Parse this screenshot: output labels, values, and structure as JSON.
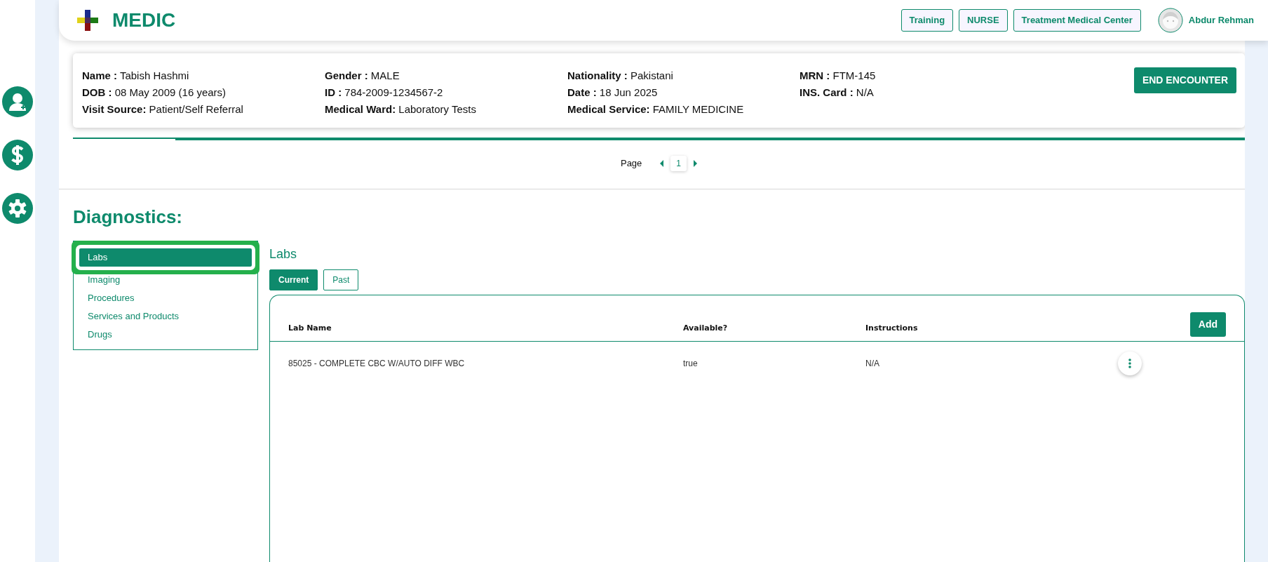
{
  "header": {
    "logo_text": "MEDIC",
    "badges": [
      "Training",
      "NURSE",
      "Treatment Medical Center"
    ],
    "user_name": "Abdur Rehman"
  },
  "patient": {
    "columns": [
      [
        {
          "label": "Name :",
          "value": "Tabish Hashmi"
        },
        {
          "label": "DOB :",
          "value": "08 May 2009 (16 years)"
        },
        {
          "label": "Visit Source:",
          "value": "Patient/Self Referral"
        }
      ],
      [
        {
          "label": "Gender :",
          "value": "MALE"
        },
        {
          "label": "ID :",
          "value": "784-2009-1234567-2"
        },
        {
          "label": "Medical Ward:",
          "value": "Laboratory Tests"
        }
      ],
      [
        {
          "label": "Nationality :",
          "value": "Pakistani"
        },
        {
          "label": "Date :",
          "value": "18 Jun 2025"
        },
        {
          "label": "Medical Service:",
          "value": "FAMILY MEDICINE"
        }
      ],
      [
        {
          "label": "MRN :",
          "value": "FTM-145"
        },
        {
          "label": "INS. Card :",
          "value": "N/A"
        }
      ]
    ],
    "end_button": "END ENCOUNTER"
  },
  "pagination": {
    "label": "Page",
    "pages": [
      {
        "label": "1",
        "selected": true
      }
    ]
  },
  "diagnostics": {
    "title": "Diagnostics:",
    "menu": [
      {
        "label": "Labs",
        "selected": true
      },
      {
        "label": "Imaging",
        "selected": false
      },
      {
        "label": "Procedures",
        "selected": false
      },
      {
        "label": "Services and Products",
        "selected": false
      },
      {
        "label": "Drugs",
        "selected": false
      }
    ]
  },
  "labs": {
    "title": "Labs",
    "tabs": [
      {
        "label": "Current",
        "selected": true
      },
      {
        "label": "Past",
        "selected": false
      }
    ],
    "table": {
      "columns": [
        "Lab Name",
        "Available?",
        "Instructions"
      ],
      "add_button": "Add",
      "rows": [
        [
          "85025 - COMPLETE CBC W/AUTO DIFF WBC",
          "true",
          "N/A"
        ]
      ]
    }
  }
}
